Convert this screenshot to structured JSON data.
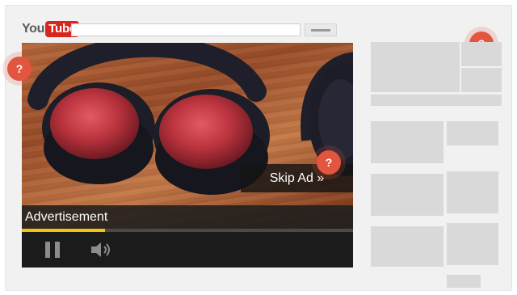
{
  "header": {
    "logo_you": "You",
    "logo_tube": "Tube"
  },
  "player": {
    "skip_ad_label": "Skip Ad »",
    "ad_label": "Advertisement",
    "ad_progress_fraction": 0.25
  },
  "help_markers": [
    "?",
    "?",
    "?"
  ],
  "colors": {
    "accent_help": "#e2553f",
    "progress": "#f1c40f",
    "logo_red": "#d6261e"
  },
  "icons": {
    "pause": "pause-icon",
    "volume": "volume-icon",
    "help": "question-mark-icon"
  }
}
